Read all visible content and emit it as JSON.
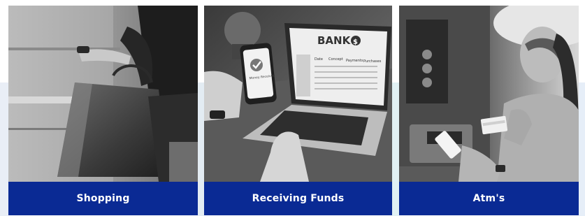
{
  "cards": [
    {
      "label": "Shopping",
      "image": "person-with-shopping-bags-photo"
    },
    {
      "label": "Receiving Funds",
      "image": "laptop-banking-photo"
    },
    {
      "label": "Atm's",
      "image": "woman-at-atm-photo"
    }
  ],
  "laptop_screen": {
    "brand": "BANK",
    "currency_symbol": "$",
    "headers": [
      "Date",
      "Concept",
      "Payments",
      "Purchases"
    ]
  },
  "phone_screen": {
    "status": "Money\nReceived"
  },
  "colors": {
    "caption_bg": "#0a2a94",
    "caption_text": "#ffffff"
  }
}
